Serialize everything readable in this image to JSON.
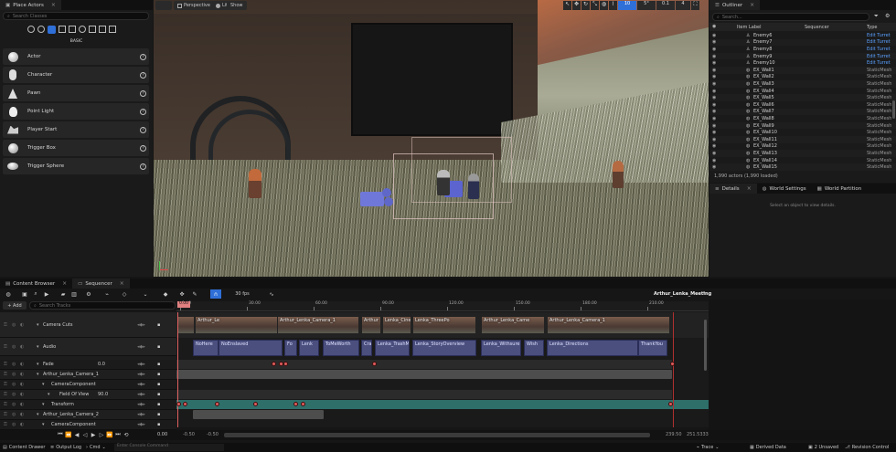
{
  "place_actors": {
    "tab": "Place Actors",
    "search_placeholder": "Search Classes",
    "category": "BASIC",
    "items": [
      {
        "label": "Actor",
        "icon": "sphere-icon"
      },
      {
        "label": "Character",
        "icon": "character-icon"
      },
      {
        "label": "Pawn",
        "icon": "pawn-icon"
      },
      {
        "label": "Point Light",
        "icon": "light-bulb-icon"
      },
      {
        "label": "Player Start",
        "icon": "player-start-icon"
      },
      {
        "label": "Trigger Box",
        "icon": "trigger-box-icon"
      },
      {
        "label": "Trigger Sphere",
        "icon": "trigger-sphere-icon"
      }
    ]
  },
  "viewport": {
    "perspective": "Perspective",
    "lit": "Lit",
    "show": "Show",
    "camera_speed": "0.1",
    "grid": "10",
    "angle": "5°",
    "screen_pct": "4"
  },
  "outliner": {
    "tab": "Outliner",
    "search_placeholder": "Search...",
    "col_label": "Item Label",
    "col_sequencer": "Sequencer",
    "col_type": "Type",
    "rows": [
      {
        "name": "Enemy6",
        "type": "Edit Turret",
        "link": true
      },
      {
        "name": "Enemy7",
        "type": "Edit Turret",
        "link": true
      },
      {
        "name": "Enemy8",
        "type": "Edit Turret",
        "link": true
      },
      {
        "name": "Enemy9",
        "type": "Edit Turret",
        "link": true
      },
      {
        "name": "Enemy10",
        "type": "Edit Turret",
        "link": true
      },
      {
        "name": "EX_Wall1",
        "type": "StaticMesh",
        "link": false
      },
      {
        "name": "EX_Wall2",
        "type": "StaticMesh",
        "link": false
      },
      {
        "name": "EX_Wall3",
        "type": "StaticMesh",
        "link": false
      },
      {
        "name": "EX_Wall4",
        "type": "StaticMesh",
        "link": false
      },
      {
        "name": "EX_Wall5",
        "type": "StaticMesh",
        "link": false
      },
      {
        "name": "EX_Wall6",
        "type": "StaticMesh",
        "link": false
      },
      {
        "name": "EX_Wall7",
        "type": "StaticMesh",
        "link": false
      },
      {
        "name": "EX_Wall8",
        "type": "StaticMesh",
        "link": false
      },
      {
        "name": "EX_Wall9",
        "type": "StaticMesh",
        "link": false
      },
      {
        "name": "EX_Wall10",
        "type": "StaticMesh",
        "link": false
      },
      {
        "name": "EX_Wall11",
        "type": "StaticMesh",
        "link": false
      },
      {
        "name": "EX_Wall12",
        "type": "StaticMesh",
        "link": false
      },
      {
        "name": "EX_Wall13",
        "type": "StaticMesh",
        "link": false
      },
      {
        "name": "EX_Wall14",
        "type": "StaticMesh",
        "link": false
      },
      {
        "name": "EX_Wall15",
        "type": "StaticMesh",
        "link": false
      }
    ],
    "footer": "1,990 actors (1,990 loaded)"
  },
  "details": {
    "tabs": [
      "Details",
      "World Settings",
      "World Partition"
    ],
    "empty": "Select an object to view details."
  },
  "bottom_tabs": {
    "content_browser": "Content Browser",
    "sequencer": "Sequencer"
  },
  "sequencer": {
    "fps": "30 fps",
    "sequence_name": "Arthur_Lenka_Meeting",
    "add_label": "+ Add",
    "search_placeholder": "Search Tracks",
    "time_current": "0.00",
    "tracks": [
      {
        "label": "Camera Cuts",
        "indent": 0
      },
      {
        "label": "Audio",
        "indent": 0
      },
      {
        "label": "Fade",
        "indent": 0,
        "value": "0.0"
      },
      {
        "label": "Arthur_Lenka_Camera_1",
        "indent": 0
      },
      {
        "label": "CameraComponent",
        "indent": 1
      },
      {
        "label": "Field Of View",
        "indent": 2,
        "value": "90.0"
      },
      {
        "label": "Transform",
        "indent": 1
      },
      {
        "label": "Arthur_Lenka_Camera_2",
        "indent": 0
      },
      {
        "label": "CameraComponent",
        "indent": 1
      }
    ],
    "ruler_marks": [
      "0.00",
      "30.00",
      "60.00",
      "90.00",
      "120.00",
      "150.00",
      "180.00",
      "210.00"
    ],
    "camera_clips": [
      "",
      "Arthur_Le",
      "Arthur_Lenka_Camera_1",
      "Arthur",
      "Lenka_Cinemati",
      "Lenka_ThreePo",
      "Arthur_Lenka_Came",
      "Arthur_Lenka_Camera_1"
    ],
    "audio_clips": [
      "NoHere",
      "NoEnslaved",
      "Fo",
      "Lenk",
      "ToMeWorth",
      "Cra",
      "Lenka_TrashM",
      "Lenka_StoryOverview",
      "Lenka_Withsure",
      "Wish",
      "Lenka_Directions",
      "ThankYou"
    ],
    "range_start": "-0.50",
    "range_start2": "-0.50",
    "range_end": "239.50",
    "range_end2": "251.5333"
  },
  "status_bar": {
    "content_drawer": "Content Drawer",
    "output_log": "Output Log",
    "cmd": "Cmd",
    "cmd_placeholder": "Enter Console Command",
    "trace": "Trace",
    "derived_data": "Derived Data",
    "unsaved": "2 Unsaved",
    "revision_control": "Revision Control"
  }
}
